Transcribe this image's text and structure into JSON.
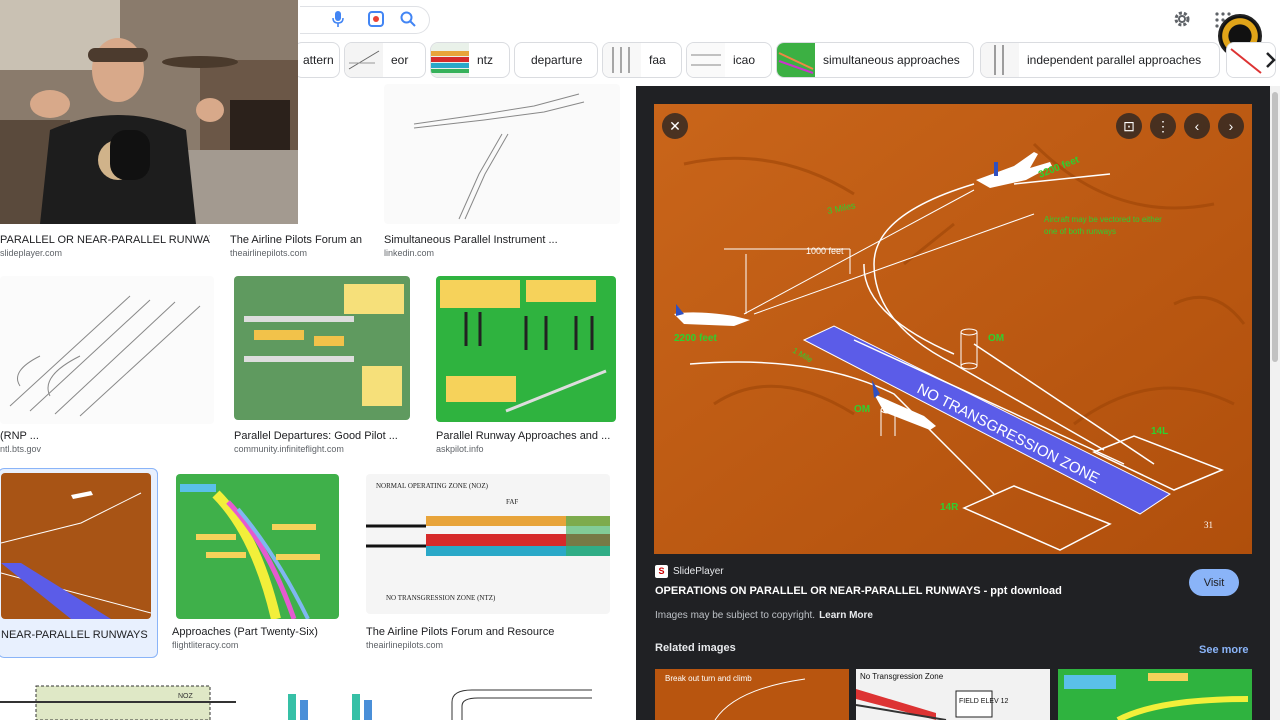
{
  "chips": [
    {
      "label": "attern",
      "has_thumb": false
    },
    {
      "label": "eor",
      "has_thumb": true
    },
    {
      "label": "ntz",
      "has_thumb": true
    },
    {
      "label": "departure",
      "has_thumb": false
    },
    {
      "label": "faa",
      "has_thumb": true
    },
    {
      "label": "icao",
      "has_thumb": true
    },
    {
      "label": "simultaneous approaches",
      "has_thumb": true
    },
    {
      "label": "independent parallel approaches",
      "has_thumb": true
    }
  ],
  "results": [
    {
      "title": "PARALLEL OR NEAR-PARALLEL RUNWAYS ...",
      "source": "slideplayer.com"
    },
    {
      "title": "The Airline Pilots Forum an...",
      "source": "theairlinepilots.com"
    },
    {
      "title": "Simultaneous Parallel Instrument ...",
      "source": "linkedin.com"
    },
    {
      "title": "(RNP ...",
      "source": "ntl.bts.gov"
    },
    {
      "title": "Parallel Departures: Good Pilot ...",
      "source": "community.infiniteflight.com"
    },
    {
      "title": "Parallel Runway Approaches and ...",
      "source": "askpilot.info"
    },
    {
      "title": "NEAR-PARALLEL RUNWAYS ...",
      "source": ""
    },
    {
      "title": "Approaches (Part Twenty-Six)",
      "source": "flightliteracy.com"
    },
    {
      "title": "The Airline Pilots Forum and Resource",
      "source": "theairlinepilots.com"
    }
  ],
  "thumb_text": {
    "noz": "NORMAL OPERATING ZONE (NOZ)",
    "ntz": "NO TRANSGRESSION ZONE (NTZ)",
    "faf": "FAF",
    "noz_short": "NOZ"
  },
  "preview": {
    "labels": {
      "ft3200": "3200 feet",
      "ft2200": "2200 feet",
      "ft1000": "1000 feet",
      "miles3": "3 Miles",
      "mile1": "1 Mile",
      "om": "OM",
      "ntz": "NO TRANSGRESSION ZONE",
      "r14l": "14L",
      "r14r": "14R",
      "vector": "Aircraft may be vectored to either",
      "vector2": "one of both runways",
      "page": "31"
    },
    "source_name": "SlidePlayer",
    "title": "OPERATIONS ON PARALLEL OR NEAR-PARALLEL RUNWAYS - ppt download",
    "copyright": "Images may be subject to copyright.",
    "learn_more": "Learn More",
    "visit": "Visit"
  },
  "related": {
    "heading": "Related images",
    "see_more": "See more",
    "r1": "Break out turn and climb",
    "r2": "No Transgression Zone",
    "r3": "FIELD ELEV 12"
  },
  "colors": {
    "preview_bg": "#c35f11",
    "ntz_blue": "#5b5ce8",
    "green_label": "#2fd02f",
    "panel_bg": "#202124",
    "link_blue": "#8ab4f8"
  }
}
